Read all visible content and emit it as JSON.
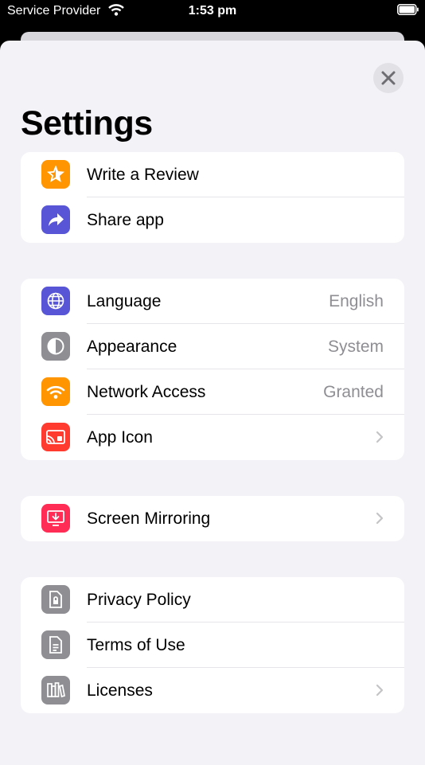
{
  "status_bar": {
    "carrier": "Service Provider",
    "time": "1:53 pm"
  },
  "page": {
    "title": "Settings"
  },
  "groups": [
    {
      "rows": [
        {
          "label": "Write a Review",
          "icon": "star-icon",
          "color": "#FF9500"
        },
        {
          "label": "Share app",
          "icon": "share-arrow-icon",
          "color": "#5856D6"
        }
      ]
    },
    {
      "rows": [
        {
          "label": "Language",
          "value": "English",
          "icon": "globe-icon",
          "color": "#5856D6"
        },
        {
          "label": "Appearance",
          "value": "System",
          "icon": "half-circle-icon",
          "color": "#8E8E93"
        },
        {
          "label": "Network Access",
          "value": "Granted",
          "icon": "wifi-icon",
          "color": "#FF9500"
        },
        {
          "label": "App Icon",
          "icon": "app-icon",
          "color": "#FF3B30"
        }
      ]
    },
    {
      "rows": [
        {
          "label": "Screen Mirroring",
          "icon": "screen-mirroring-icon",
          "color": "#FF2D55"
        }
      ]
    },
    {
      "rows": [
        {
          "label": "Privacy Policy",
          "icon": "lock-document-icon",
          "color": "#8E8E93"
        },
        {
          "label": "Terms of Use",
          "icon": "document-icon",
          "color": "#8E8E93"
        },
        {
          "label": "Licenses",
          "icon": "books-icon",
          "color": "#8E8E93"
        }
      ]
    }
  ]
}
